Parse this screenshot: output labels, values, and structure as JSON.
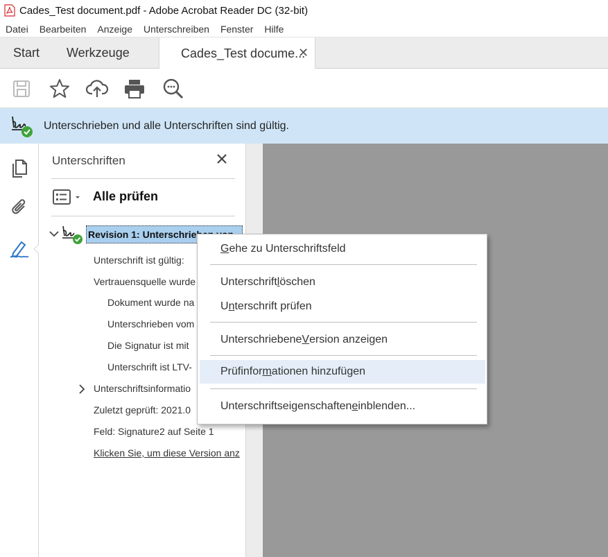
{
  "window": {
    "title": "Cades_Test document.pdf - Adobe Acrobat Reader DC (32-bit)"
  },
  "menu": [
    "Datei",
    "Bearbeiten",
    "Anzeige",
    "Unterschreiben",
    "Fenster",
    "Hilfe"
  ],
  "tabs": {
    "start": "Start",
    "tools": "Werkzeuge",
    "document": "Cades_Test docume...",
    "close_glyph": "✕"
  },
  "toolbar": {
    "icons": [
      "save-icon",
      "bookmark-star-icon",
      "upload-cloud-icon",
      "print-icon",
      "search-zoom-icon"
    ]
  },
  "banner": {
    "text": "Unterschrieben und alle Unterschriften sind gültig.",
    "icon": "signature-valid-icon"
  },
  "rail": {
    "icons": [
      "page-thumbnails-icon",
      "attachments-icon",
      "signatures-pen-icon"
    ]
  },
  "panel": {
    "title": "Unterschriften",
    "check_all": "Alle prüfen",
    "revision_label": "Revision 1: Unterschrieben von ",
    "rows": [
      "Unterschrift ist gültig:",
      "Vertrauensquelle wurde",
      "Dokument wurde na",
      "Unterschrieben vom",
      "Die Signatur ist mit",
      "Unterschrift ist LTV-",
      "Unterschriftsinformatio",
      "Zuletzt geprüft: 2021.0",
      "Feld: Signature2 auf Seite 1",
      "Klicken Sie, um diese Version anz"
    ]
  },
  "context_menu": {
    "items": [
      {
        "pre": "",
        "ul": "G",
        "post": "ehe zu Unterschriftsfeld"
      },
      {
        "pre": "Unterschrift ",
        "ul": "l",
        "post": "öschen"
      },
      {
        "pre": "U",
        "ul": "n",
        "post": "terschrift prüfen"
      },
      {
        "pre": "Unterschriebene ",
        "ul": "V",
        "post": "ersion anzeigen"
      },
      {
        "pre": "Prüfinfor",
        "ul": "m",
        "post": "ationen hinzufügen"
      },
      {
        "pre": "Unterschriftseigenschaften ",
        "ul": "e",
        "post": "inblenden..."
      }
    ]
  },
  "colors": {
    "banner_bg": "#cfe5f7",
    "accent_blue": "#2a76c6",
    "valid_green": "#3fa33a",
    "doc_bg": "#999999",
    "highlight": "#e5eef8"
  }
}
